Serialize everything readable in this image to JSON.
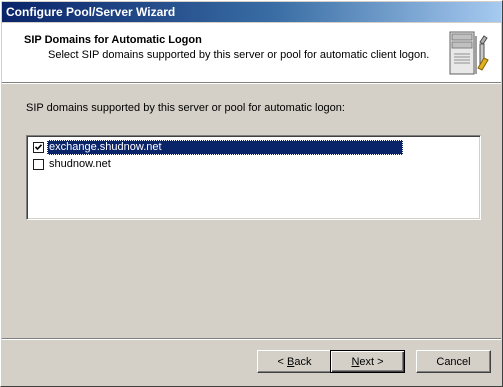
{
  "window": {
    "title": "Configure Pool/Server Wizard"
  },
  "header": {
    "title": "SIP Domains for Automatic Logon",
    "subtitle": "Select SIP domains supported by this server or pool for automatic client logon.",
    "icon": "server-with-tools-icon"
  },
  "main": {
    "prompt": "SIP domains supported by this server or pool for automatic logon:",
    "domains": [
      {
        "label": "exchange.shudnow.net",
        "checked": true,
        "selected": true
      },
      {
        "label": "shudnow.net",
        "checked": false,
        "selected": false
      }
    ]
  },
  "buttons": {
    "back": {
      "mnemonic": "B",
      "rest": "ack",
      "prefix": "< "
    },
    "next": {
      "mnemonic": "N",
      "rest": "ext",
      "suffix": " >"
    },
    "cancel": "Cancel"
  },
  "colors": {
    "title_bar": "#0a246a",
    "selection": "#0a246a",
    "face": "#d4d0c8"
  }
}
